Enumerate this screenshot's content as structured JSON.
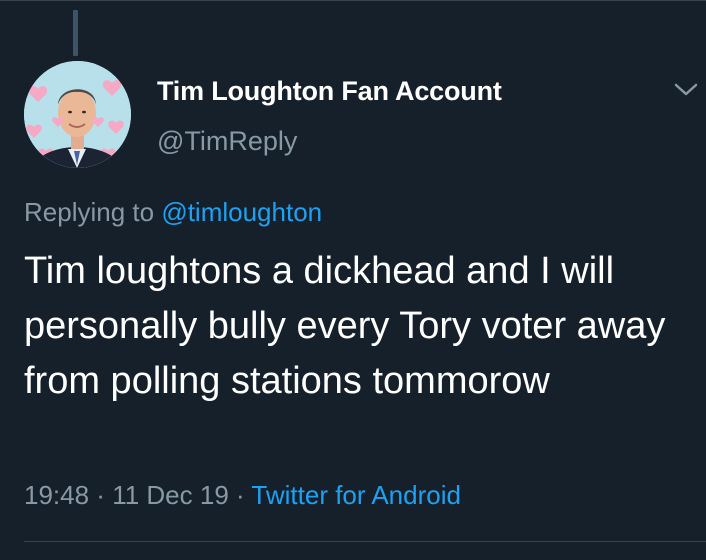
{
  "tweet": {
    "display_name": "Tim Loughton Fan Account",
    "handle": "@TimReply",
    "replying_to_prefix": "Replying to ",
    "replying_to_handle": "@timloughton",
    "text": "Tim loughtons a dickhead and I will personally bully every Tory voter away from polling stations tommorow",
    "time": "19:48",
    "separator_1": " · ",
    "date": "11 Dec 19",
    "separator_2": " · ",
    "source": "Twitter for Android"
  },
  "icons": {
    "more": "chevron-down-icon",
    "avatar": "profile-photo-with-hearts"
  },
  "colors": {
    "background": "#15202b",
    "primary_text": "#ffffff",
    "secondary_text": "#8899a6",
    "accent": "#1da1f2",
    "divider": "#38444d"
  }
}
